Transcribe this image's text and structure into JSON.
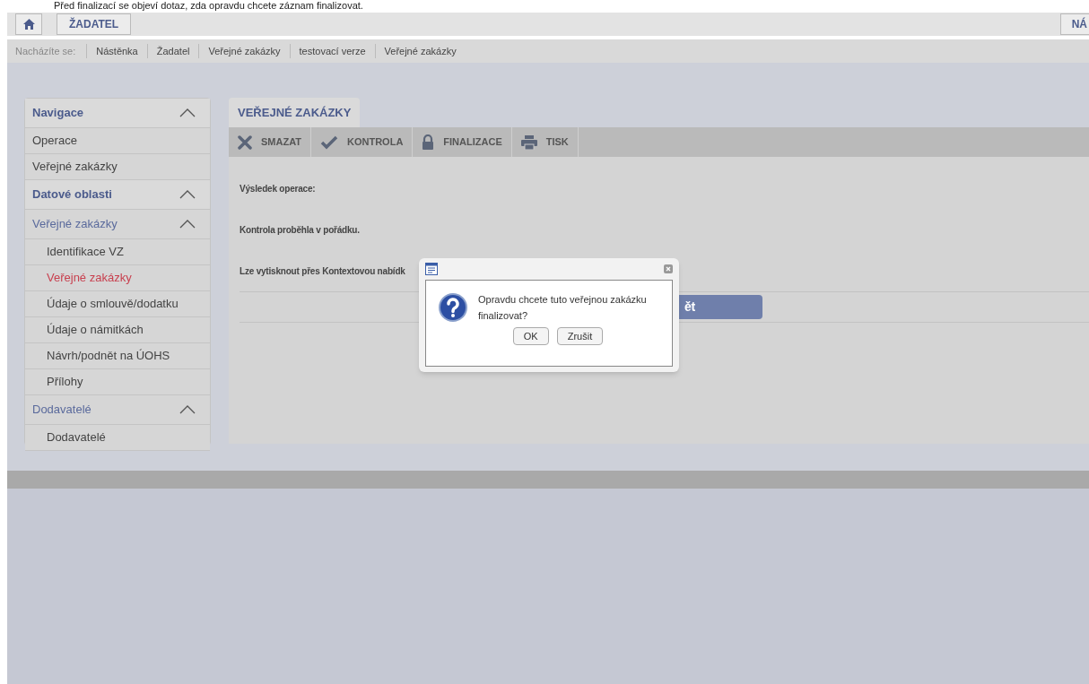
{
  "caption": "Před finalizací se objeví dotaz, zda opravdu chcete záznam finalizovat.",
  "top_bar": {
    "buttons": [
      "ŽADATEL"
    ],
    "right_button": "NÁ"
  },
  "breadcrumb": {
    "label": "Nacházíte se:",
    "items": [
      "Nástěnka",
      "Žadatel",
      "Veřejné zakázky",
      "testovací verze",
      "Veřejné zakázky"
    ]
  },
  "sidebar": {
    "items": [
      {
        "kind": "header",
        "label": "Navigace",
        "expanded": true
      },
      {
        "kind": "item",
        "label": "Operace",
        "selected": false
      },
      {
        "kind": "item",
        "label": "Veřejné zakázky",
        "selected": false
      },
      {
        "kind": "header",
        "label": "Datové oblasti",
        "expanded": true
      },
      {
        "kind": "group",
        "label": "Veřejné zakázky",
        "expanded": true
      },
      {
        "kind": "subitem",
        "label": "Identifikace VZ",
        "selected": false
      },
      {
        "kind": "subitem",
        "label": "Veřejné zakázky",
        "selected": true
      },
      {
        "kind": "subitem",
        "label": "Údaje o smlouvě/dodatku",
        "selected": false
      },
      {
        "kind": "subitem",
        "label": "Údaje o námitkách",
        "selected": false
      },
      {
        "kind": "subitem",
        "label": "Návrh/podnět na ÚOHS",
        "selected": false
      },
      {
        "kind": "subitem",
        "label": "Přílohy",
        "selected": false
      },
      {
        "kind": "group",
        "label": "Dodavatelé",
        "expanded": true
      },
      {
        "kind": "subitem",
        "label": "Dodavatelé",
        "selected": false
      }
    ]
  },
  "main": {
    "tab": "VEŘEJNÉ ZAKÁZKY",
    "toolbar": [
      {
        "kind": "delete",
        "label": "SMAZAT"
      },
      {
        "kind": "check",
        "label": "KONTROLA"
      },
      {
        "kind": "lock",
        "label": "FINALIZACE"
      },
      {
        "kind": "print",
        "label": "TISK"
      }
    ],
    "lines": [
      "Výsledek operace:",
      "Kontrola proběhla v pořádku.",
      "Lze vytisknout přes Kontextovou nabídk"
    ],
    "back_button": "ět"
  },
  "dialog": {
    "message": "Opravdu chcete tuto veřejnou zakázku finalizovat?",
    "buttons": [
      "OK",
      "Zrušit"
    ]
  }
}
